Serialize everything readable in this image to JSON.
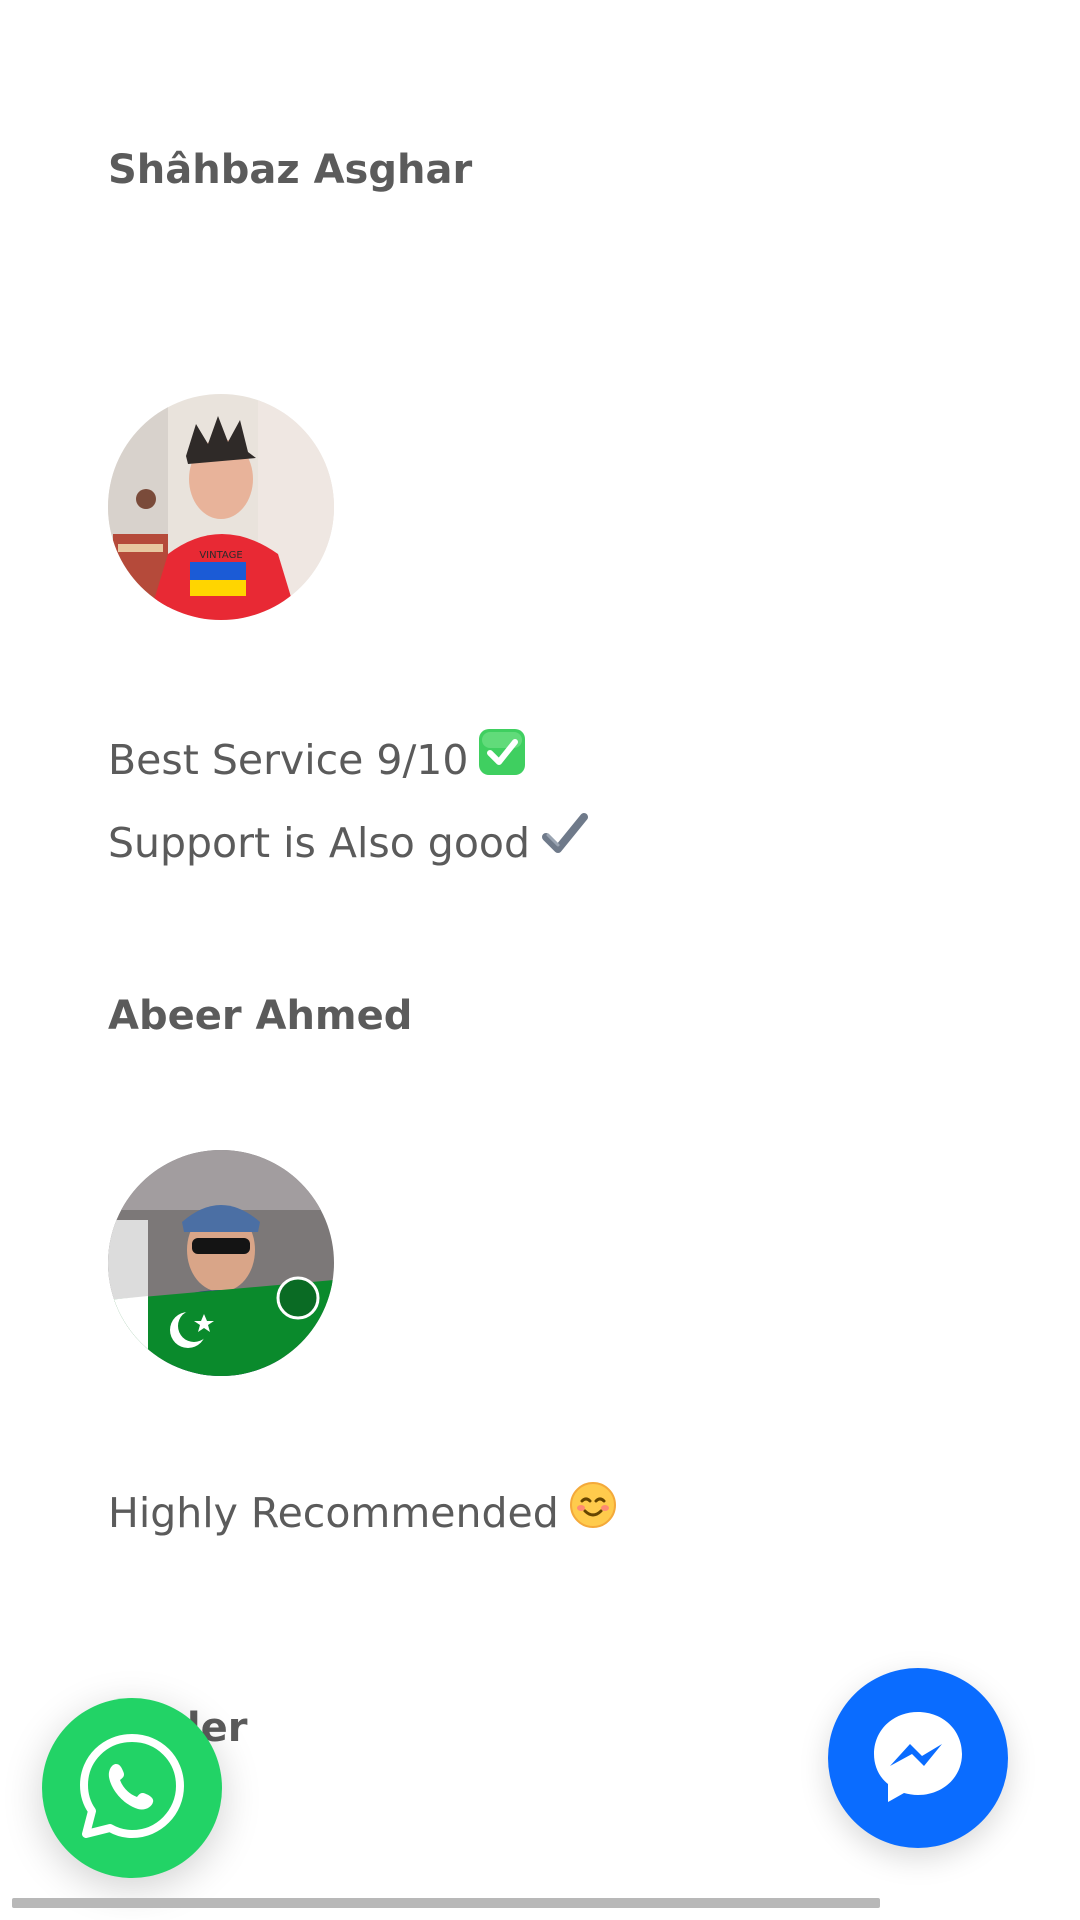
{
  "reviews": [
    {
      "name": "Shâhbaz Asghar",
      "lines": [
        "Best Service 9/10",
        "Support is Also good"
      ],
      "emojis": [
        "check-mark-button-icon",
        "check-mark-icon"
      ]
    },
    {
      "name": "Abeer Ahmed",
      "lines": [
        "Highly Recommended"
      ],
      "emojis": [
        "smiling-face-with-hearts-icon"
      ]
    },
    {
      "name": "der",
      "lines": [],
      "emojis": []
    }
  ],
  "buttons": {
    "whatsapp": "whatsapp-icon",
    "messenger": "messenger-icon"
  },
  "colors": {
    "text": "#5b5b5b",
    "whatsapp": "#22d366",
    "messenger": "#0a6cff",
    "scrollbar": "#b8b8b8"
  }
}
